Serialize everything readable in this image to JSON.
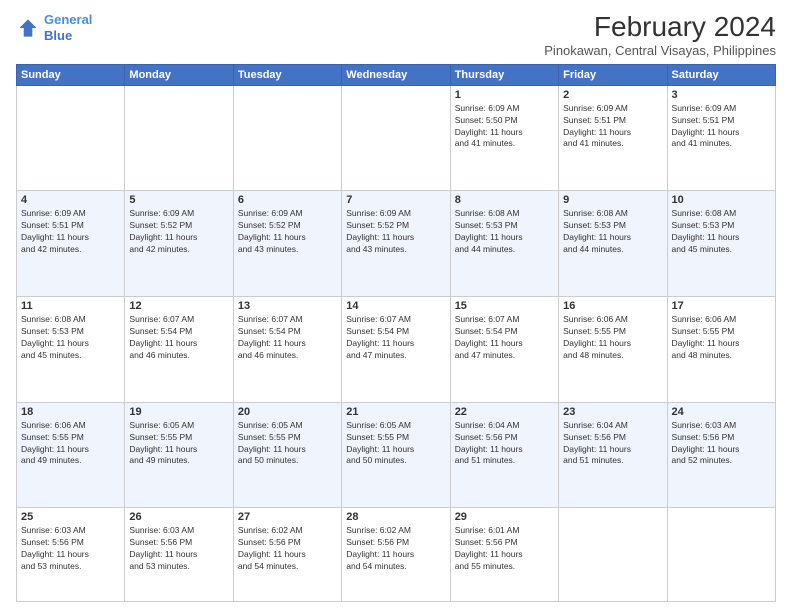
{
  "logo": {
    "line1": "General",
    "line2": "Blue"
  },
  "title": "February 2024",
  "subtitle": "Pinokawan, Central Visayas, Philippines",
  "days_of_week": [
    "Sunday",
    "Monday",
    "Tuesday",
    "Wednesday",
    "Thursday",
    "Friday",
    "Saturday"
  ],
  "weeks": [
    [
      {
        "day": "",
        "info": ""
      },
      {
        "day": "",
        "info": ""
      },
      {
        "day": "",
        "info": ""
      },
      {
        "day": "",
        "info": ""
      },
      {
        "day": "1",
        "info": "Sunrise: 6:09 AM\nSunset: 5:50 PM\nDaylight: 11 hours\nand 41 minutes."
      },
      {
        "day": "2",
        "info": "Sunrise: 6:09 AM\nSunset: 5:51 PM\nDaylight: 11 hours\nand 41 minutes."
      },
      {
        "day": "3",
        "info": "Sunrise: 6:09 AM\nSunset: 5:51 PM\nDaylight: 11 hours\nand 41 minutes."
      }
    ],
    [
      {
        "day": "4",
        "info": "Sunrise: 6:09 AM\nSunset: 5:51 PM\nDaylight: 11 hours\nand 42 minutes."
      },
      {
        "day": "5",
        "info": "Sunrise: 6:09 AM\nSunset: 5:52 PM\nDaylight: 11 hours\nand 42 minutes."
      },
      {
        "day": "6",
        "info": "Sunrise: 6:09 AM\nSunset: 5:52 PM\nDaylight: 11 hours\nand 43 minutes."
      },
      {
        "day": "7",
        "info": "Sunrise: 6:09 AM\nSunset: 5:52 PM\nDaylight: 11 hours\nand 43 minutes."
      },
      {
        "day": "8",
        "info": "Sunrise: 6:08 AM\nSunset: 5:53 PM\nDaylight: 11 hours\nand 44 minutes."
      },
      {
        "day": "9",
        "info": "Sunrise: 6:08 AM\nSunset: 5:53 PM\nDaylight: 11 hours\nand 44 minutes."
      },
      {
        "day": "10",
        "info": "Sunrise: 6:08 AM\nSunset: 5:53 PM\nDaylight: 11 hours\nand 45 minutes."
      }
    ],
    [
      {
        "day": "11",
        "info": "Sunrise: 6:08 AM\nSunset: 5:53 PM\nDaylight: 11 hours\nand 45 minutes."
      },
      {
        "day": "12",
        "info": "Sunrise: 6:07 AM\nSunset: 5:54 PM\nDaylight: 11 hours\nand 46 minutes."
      },
      {
        "day": "13",
        "info": "Sunrise: 6:07 AM\nSunset: 5:54 PM\nDaylight: 11 hours\nand 46 minutes."
      },
      {
        "day": "14",
        "info": "Sunrise: 6:07 AM\nSunset: 5:54 PM\nDaylight: 11 hours\nand 47 minutes."
      },
      {
        "day": "15",
        "info": "Sunrise: 6:07 AM\nSunset: 5:54 PM\nDaylight: 11 hours\nand 47 minutes."
      },
      {
        "day": "16",
        "info": "Sunrise: 6:06 AM\nSunset: 5:55 PM\nDaylight: 11 hours\nand 48 minutes."
      },
      {
        "day": "17",
        "info": "Sunrise: 6:06 AM\nSunset: 5:55 PM\nDaylight: 11 hours\nand 48 minutes."
      }
    ],
    [
      {
        "day": "18",
        "info": "Sunrise: 6:06 AM\nSunset: 5:55 PM\nDaylight: 11 hours\nand 49 minutes."
      },
      {
        "day": "19",
        "info": "Sunrise: 6:05 AM\nSunset: 5:55 PM\nDaylight: 11 hours\nand 49 minutes."
      },
      {
        "day": "20",
        "info": "Sunrise: 6:05 AM\nSunset: 5:55 PM\nDaylight: 11 hours\nand 50 minutes."
      },
      {
        "day": "21",
        "info": "Sunrise: 6:05 AM\nSunset: 5:55 PM\nDaylight: 11 hours\nand 50 minutes."
      },
      {
        "day": "22",
        "info": "Sunrise: 6:04 AM\nSunset: 5:56 PM\nDaylight: 11 hours\nand 51 minutes."
      },
      {
        "day": "23",
        "info": "Sunrise: 6:04 AM\nSunset: 5:56 PM\nDaylight: 11 hours\nand 51 minutes."
      },
      {
        "day": "24",
        "info": "Sunrise: 6:03 AM\nSunset: 5:56 PM\nDaylight: 11 hours\nand 52 minutes."
      }
    ],
    [
      {
        "day": "25",
        "info": "Sunrise: 6:03 AM\nSunset: 5:56 PM\nDaylight: 11 hours\nand 53 minutes."
      },
      {
        "day": "26",
        "info": "Sunrise: 6:03 AM\nSunset: 5:56 PM\nDaylight: 11 hours\nand 53 minutes."
      },
      {
        "day": "27",
        "info": "Sunrise: 6:02 AM\nSunset: 5:56 PM\nDaylight: 11 hours\nand 54 minutes."
      },
      {
        "day": "28",
        "info": "Sunrise: 6:02 AM\nSunset: 5:56 PM\nDaylight: 11 hours\nand 54 minutes."
      },
      {
        "day": "29",
        "info": "Sunrise: 6:01 AM\nSunset: 5:56 PM\nDaylight: 11 hours\nand 55 minutes."
      },
      {
        "day": "",
        "info": ""
      },
      {
        "day": "",
        "info": ""
      }
    ]
  ]
}
